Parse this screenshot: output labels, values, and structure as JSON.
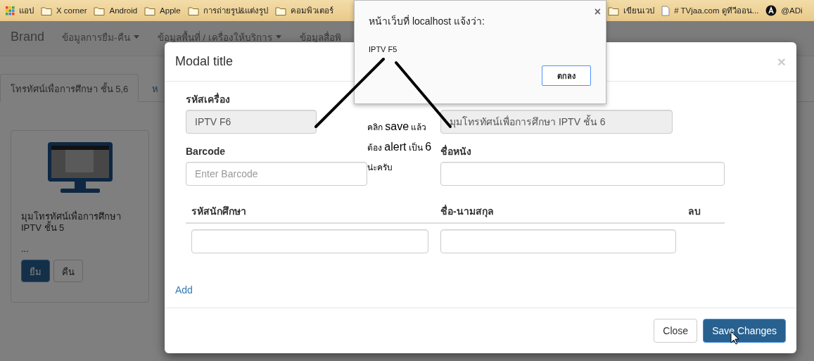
{
  "bookmarks_bar": {
    "items": [
      {
        "kind": "apps",
        "label": "แอป"
      },
      {
        "kind": "folder",
        "label": "X corner"
      },
      {
        "kind": "folder",
        "label": "Android"
      },
      {
        "kind": "folder",
        "label": "Apple"
      },
      {
        "kind": "folder",
        "label": "การถ่ายรูป&แต่งรูป"
      },
      {
        "kind": "folder",
        "label": "คอมพิวเตอร์"
      },
      {
        "kind": "folder",
        "label": "เขียนเวป"
      },
      {
        "kind": "page",
        "label": "# TVjaa.com ดูทีวีออน..."
      },
      {
        "kind": "account",
        "label": "@ADi"
      }
    ]
  },
  "navbar": {
    "brand": "Brand",
    "items": [
      {
        "label": "ข้อมูลการยืม-คืน",
        "dropdown": true
      },
      {
        "label": "ข้อมูลพื้นที่ / เครื่องให้บริการ",
        "dropdown": true
      },
      {
        "label": "ข้อมูลสื่อพิ",
        "dropdown": false
      }
    ]
  },
  "tabs": [
    {
      "label": "โทรทัศน์เพื่อการศึกษา ชั้น 5,6",
      "selected": true
    },
    {
      "label": "ห",
      "selected": false
    }
  ],
  "card": {
    "title": "มุมโทรทัศน์เพื่อการศึกษา IPTV ชั้น 5",
    "description": "...",
    "buttons": [
      {
        "label": "ยืม",
        "kind": "primary"
      },
      {
        "label": "คืน",
        "kind": "default"
      }
    ]
  },
  "modal": {
    "title": "Modal title",
    "close": "×",
    "fields": [
      {
        "label": "รหัสเครื่อง",
        "value": "IPTV F6",
        "readonly": true
      },
      {
        "value": "มุมโทรทัศน์เพื่อการศึกษา IPTV ชั้น 6",
        "readonly": true
      },
      {
        "label": "Barcode",
        "placeholder": "Enter Barcode",
        "readonly": false
      },
      {
        "label": "ชื่อหนัง",
        "readonly": false
      }
    ],
    "table": {
      "columns": [
        "รหัสนักศึกษา",
        "ชื่อ-นามสกุล",
        "ลบ"
      ],
      "rows": [
        {
          "kind": "input"
        }
      ]
    },
    "add_link": "Add",
    "footer_buttons": [
      {
        "label": "Close",
        "kind": "default"
      },
      {
        "label": "Save Changes",
        "kind": "primary"
      }
    ]
  },
  "annotation": {
    "lines": [
      "คลิก **save** แล้ว",
      "ต้อง **alert** เป็น **6**",
      "น่ะครับ"
    ]
  },
  "alert": {
    "title": "หน้าเว็บที่ localhost แจ้งว่า:",
    "message": "IPTV F5",
    "close": "×",
    "button": "ตกลง"
  }
}
